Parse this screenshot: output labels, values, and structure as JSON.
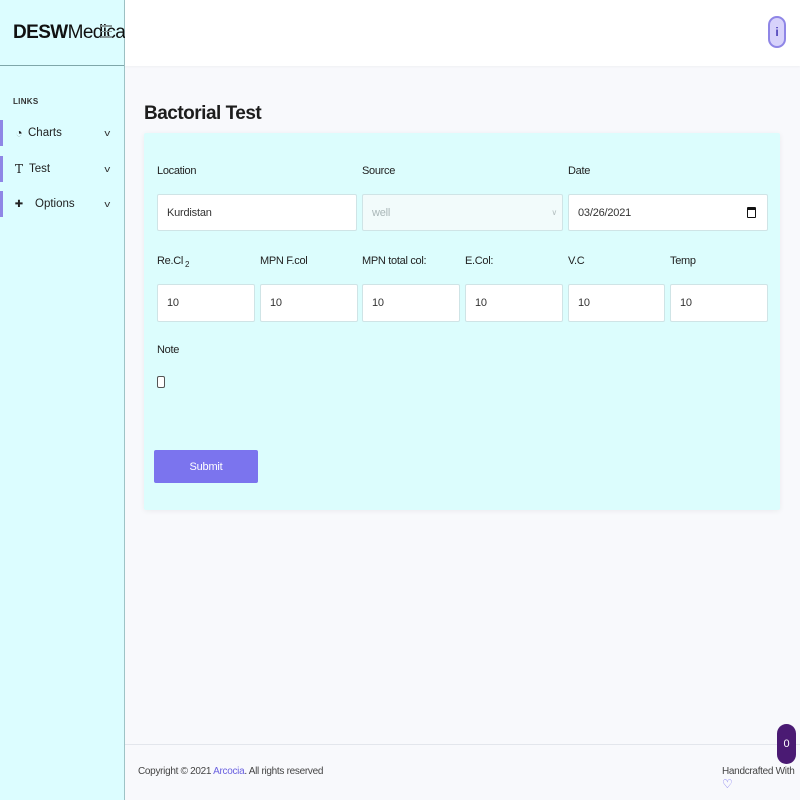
{
  "brand": {
    "bold": "DESW",
    "regular": "Medical"
  },
  "sidebar": {
    "section_label": "LINKS",
    "items": [
      {
        "label": "Charts",
        "icon": "pie-chart-icon",
        "glyph": "◔"
      },
      {
        "label": "Test",
        "icon": "type-icon",
        "glyph": "T"
      },
      {
        "label": "Options",
        "icon": "plus-circle-icon",
        "glyph": "✚"
      }
    ],
    "chevron": "v"
  },
  "page": {
    "title": "Bactorial Test"
  },
  "form": {
    "location": {
      "label": "Location",
      "value": "Kurdistan"
    },
    "source": {
      "label": "Source",
      "value": "well"
    },
    "date": {
      "label": "Date",
      "value": "03/26/2021"
    },
    "recl": {
      "label": "Re.Cl",
      "subscript": "2",
      "value": "10"
    },
    "mpn_fcol": {
      "label": "MPN F.col",
      "value": "10"
    },
    "mpn_total": {
      "label": "MPN total col:",
      "value": "10"
    },
    "ecol": {
      "label": "E.Col:",
      "value": "10"
    },
    "vc": {
      "label": "V.C",
      "value": "10"
    },
    "temp": {
      "label": "Temp",
      "value": "10"
    },
    "note": {
      "label": "Note"
    },
    "submit": "Submit"
  },
  "footer": {
    "copyright_prefix": "Copyright © 2021 ",
    "copyright_link": "Arcocia",
    "copyright_suffix": ". All rights reserved",
    "handcrafted": "Handcrafted With ",
    "heart": "♡"
  },
  "badge_count": "0",
  "colors": {
    "accent": "#7b74ee",
    "card_bg": "#dcfdfd",
    "sidebar_bg": "#dcfdff",
    "badge_bg": "#4a1a73"
  }
}
